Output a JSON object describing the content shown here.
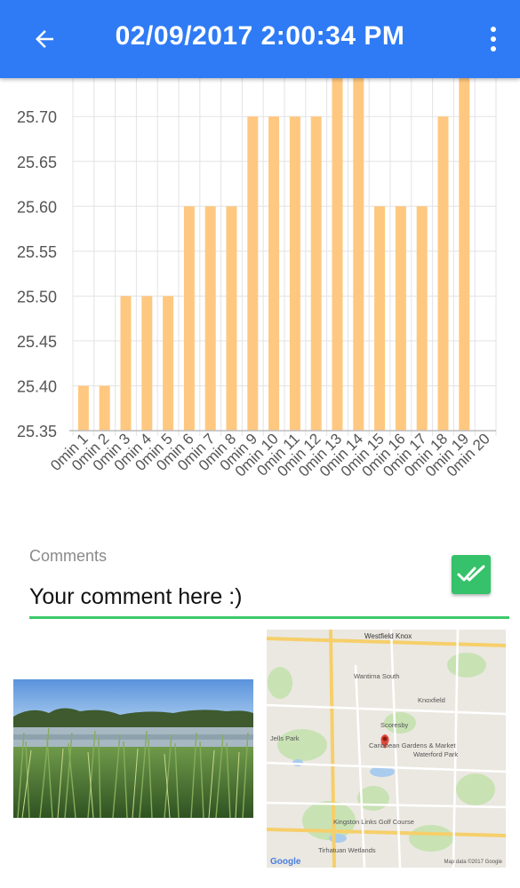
{
  "header": {
    "title": "02/09/2017 2:00:34 PM",
    "back_icon": "arrow-left-icon",
    "menu_icon": "more-vert-icon",
    "color": "#2f7bf5"
  },
  "chart_data": {
    "type": "bar",
    "categories": [
      "0min 1",
      "0min 2",
      "0min 3",
      "0min 4",
      "0min 5",
      "0min 6",
      "0min 7",
      "0min 8",
      "0min 9",
      "0min 10",
      "0min 11",
      "0min 12",
      "0min 13",
      "0min 14",
      "0min 15",
      "0min 16",
      "0min 17",
      "0min 18",
      "0min 19",
      "0min 20"
    ],
    "values": [
      25.4,
      25.4,
      25.5,
      25.5,
      25.5,
      25.6,
      25.6,
      25.6,
      25.7,
      25.7,
      25.7,
      25.7,
      25.8,
      25.8,
      25.6,
      25.6,
      25.6,
      25.7,
      25.8,
      null
    ],
    "yticks": [
      "25.35",
      "25.40",
      "25.45",
      "25.50",
      "25.55",
      "25.60",
      "25.65",
      "25.70"
    ],
    "ylim": [
      25.35,
      25.72
    ],
    "bar_color": "#ffc880",
    "grid": true
  },
  "comments": {
    "label": "Comments",
    "value": "Your comment here :)",
    "accent": "#3cc96a"
  },
  "confirm_button": {
    "icon": "double-check-icon"
  },
  "map": {
    "labels": {
      "westfield": "Westfield Knox",
      "wantirna": "Wantirna South",
      "knoxfield": "Knoxfield",
      "scoresby": "Scoresby",
      "caribbean": "Caribbean Gardens & Market",
      "waterford": "Waterford Park",
      "jells": "Jells Park",
      "kingston": "Kingston Links Golf Course",
      "tirhatuan": "Tirhatuan Wetlands",
      "google": "Google",
      "mapdata": "Map data ©2017 Google"
    }
  }
}
